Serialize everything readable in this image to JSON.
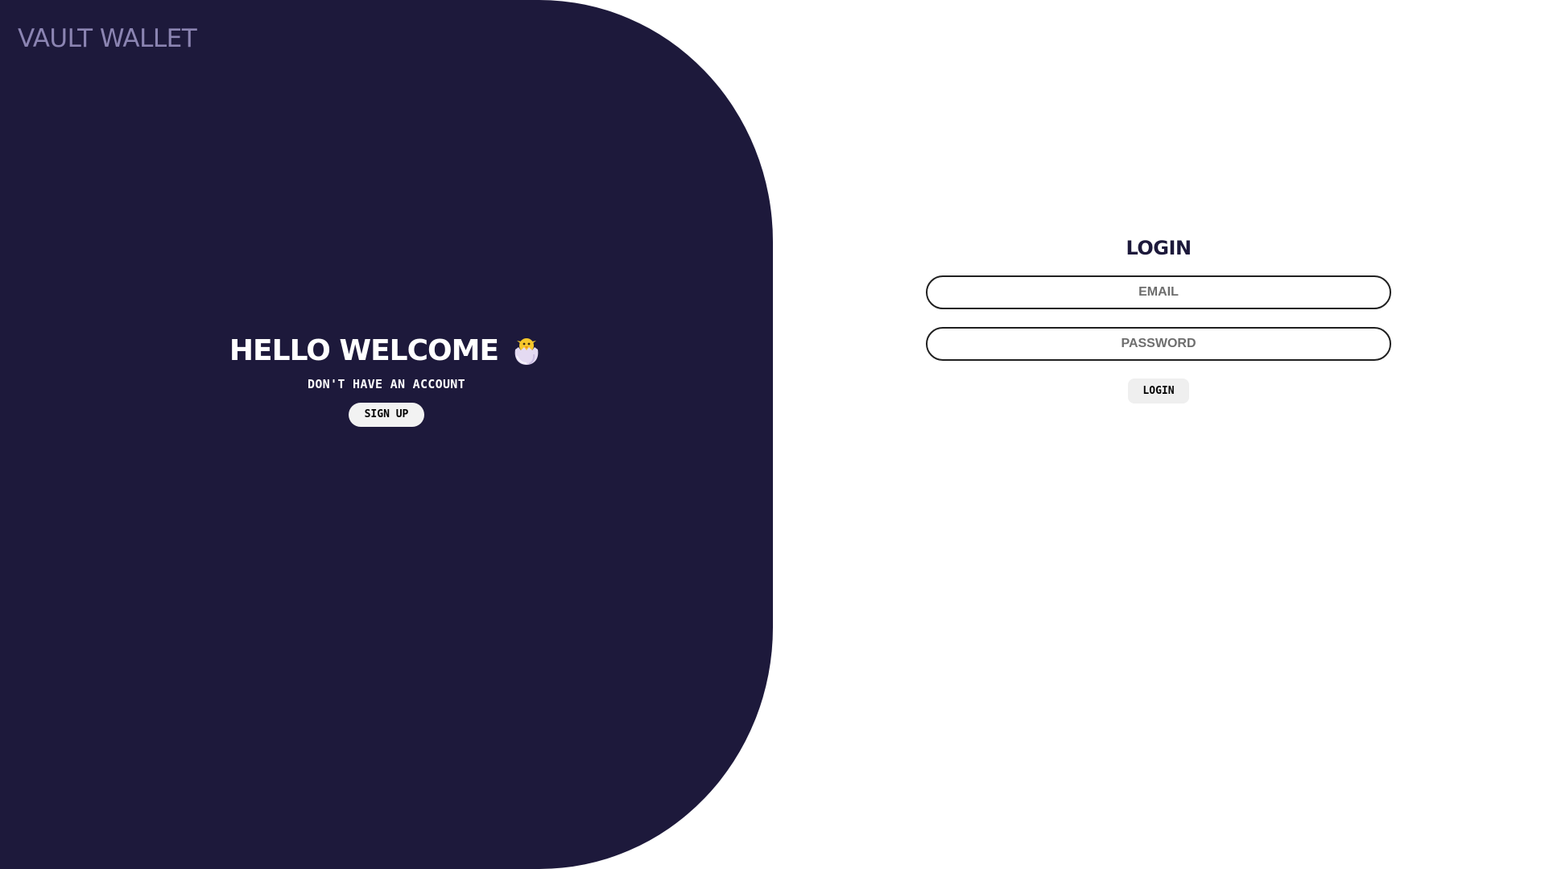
{
  "app": {
    "brand": "VAULT WALLET"
  },
  "welcome": {
    "title": "HELLO WELCOME",
    "icon": "hatching-chick-icon",
    "subtitle": "DON'T HAVE AN ACCOUNT",
    "signup_label": "SIGN UP"
  },
  "login": {
    "title": "LOGIN",
    "email_placeholder": "EMAIL",
    "email_value": "",
    "password_placeholder": "PASSWORD",
    "password_value": "",
    "submit_label": "LOGIN"
  },
  "colors": {
    "panel_bg": "#1d193b",
    "brand_text": "#8b84b2",
    "page_bg": "#ffffff",
    "button_bg": "#f2f2f2"
  }
}
